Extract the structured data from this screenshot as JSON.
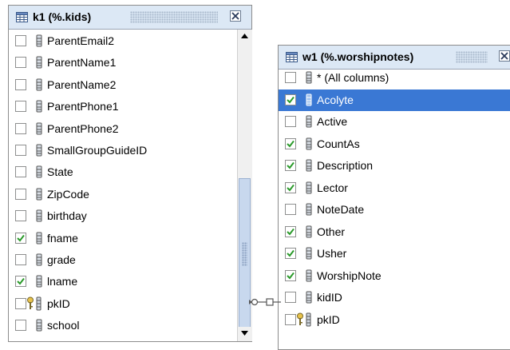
{
  "tables": [
    {
      "title": "k1 (%.kids)",
      "rows": [
        {
          "label": "ParentEmail2",
          "checked": false,
          "key": false
        },
        {
          "label": "ParentName1",
          "checked": false,
          "key": false
        },
        {
          "label": "ParentName2",
          "checked": false,
          "key": false
        },
        {
          "label": "ParentPhone1",
          "checked": false,
          "key": false
        },
        {
          "label": "ParentPhone2",
          "checked": false,
          "key": false
        },
        {
          "label": "SmallGroupGuideID",
          "checked": false,
          "key": false
        },
        {
          "label": "State",
          "checked": false,
          "key": false
        },
        {
          "label": "ZipCode",
          "checked": false,
          "key": false
        },
        {
          "label": "birthday",
          "checked": false,
          "key": false
        },
        {
          "label": "fname",
          "checked": true,
          "key": false
        },
        {
          "label": "grade",
          "checked": false,
          "key": false
        },
        {
          "label": "lname",
          "checked": true,
          "key": false
        },
        {
          "label": "pkID",
          "checked": false,
          "key": true
        },
        {
          "label": "school",
          "checked": false,
          "key": false
        }
      ]
    },
    {
      "title": "w1 (%.worshipnotes)",
      "rows": [
        {
          "label": "* (All columns)",
          "checked": false,
          "key": false
        },
        {
          "label": "Acolyte",
          "checked": true,
          "key": false,
          "selected": true
        },
        {
          "label": "Active",
          "checked": false,
          "key": false
        },
        {
          "label": "CountAs",
          "checked": true,
          "key": false
        },
        {
          "label": "Description",
          "checked": true,
          "key": false
        },
        {
          "label": "Lector",
          "checked": true,
          "key": false
        },
        {
          "label": "NoteDate",
          "checked": false,
          "key": false
        },
        {
          "label": "Other",
          "checked": true,
          "key": false
        },
        {
          "label": "Usher",
          "checked": true,
          "key": false
        },
        {
          "label": "WorshipNote",
          "checked": true,
          "key": false
        },
        {
          "label": "kidID",
          "checked": false,
          "key": false
        },
        {
          "label": "pkID",
          "checked": false,
          "key": true
        }
      ]
    }
  ],
  "colors": {
    "titlebar": "#dce8f5",
    "selection": "#3a78d4",
    "checkmark": "#2a9a2a",
    "border": "#8c8c8c"
  },
  "icons": {
    "table": "grid-table-icon",
    "column": "column-icon",
    "key": "primary-key-icon",
    "close": "close-icon",
    "relation": "join-connector"
  }
}
